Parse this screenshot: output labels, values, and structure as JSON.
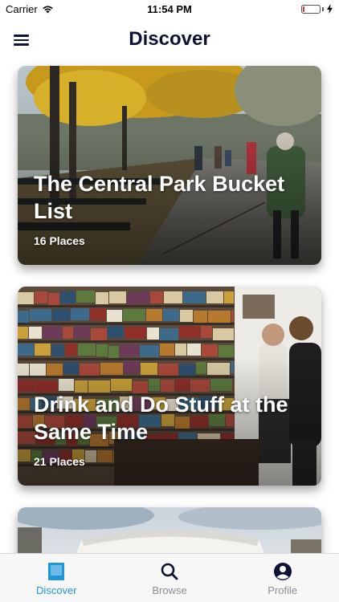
{
  "status_bar": {
    "carrier": "Carrier",
    "time": "11:54 PM",
    "battery_level": 0.12,
    "battery_color": "#e0302a"
  },
  "nav": {
    "title": "Discover",
    "menu_icon": "hamburger-menu-icon"
  },
  "cards": [
    {
      "title": "The Central Park Bucket List",
      "count": "16 Places",
      "image": "central-park-autumn-path"
    },
    {
      "title": "Drink and Do Stuff at the Same Time",
      "count": "21 Places",
      "image": "board-game-cafe-shelves"
    },
    {
      "title": "",
      "count": "",
      "image": "guggenheim-museum"
    }
  ],
  "tab_bar": {
    "active": "Discover",
    "accent_color": "#2196d6",
    "tabs": [
      {
        "label": "Discover",
        "icon": "discover-square-icon"
      },
      {
        "label": "Browse",
        "icon": "search-icon"
      },
      {
        "label": "Profile",
        "icon": "profile-icon"
      }
    ]
  }
}
